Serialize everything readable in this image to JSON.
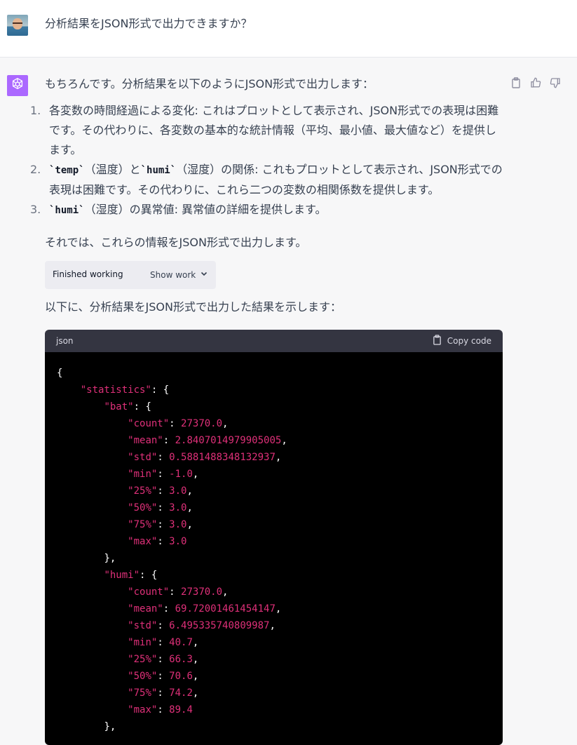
{
  "user_message": "分析結果をJSON形式で出力できますか？",
  "assistant": {
    "intro": "もちろんです。分析結果を以下のようにJSON形式で出力します：",
    "steps": [
      {
        "number": "1.",
        "code": "",
        "text": "各変数の時間経過による変化: これはプロットとして表示され、JSON形式での表現は困難です。その代わりに、各変数の基本的な統計情報（平均、最小値、最大値など）を提供します。"
      },
      {
        "number": "2.",
        "code": "`temp`",
        "mid": "（温度）と",
        "code2": "`humi`",
        "text": "（湿度）の関係: これもプロットとして表示され、JSON形式での表現は困難です。その代わりに、これら二つの変数の相関係数を提供します。"
      },
      {
        "number": "3.",
        "code": "`humi`",
        "text": "（湿度）の異常値: 異常値の詳細を提供します。"
      }
    ],
    "then_text": "それでは、これらの情報をJSON形式で出力します。",
    "finished_working": "Finished working",
    "show_work": "Show work",
    "below_text": "以下に、分析結果をJSON形式で出力した結果を示します：",
    "code_lang": "json",
    "copy_label": "Copy code"
  },
  "json_output": {
    "statistics_key": "\"statistics\"",
    "bat_key": "\"bat\"",
    "bat": [
      [
        "\"count\"",
        "27370.0"
      ],
      [
        "\"mean\"",
        "2.8407014979905005"
      ],
      [
        "\"std\"",
        "0.5881488348132937"
      ],
      [
        "\"min\"",
        "-1.0"
      ],
      [
        "\"25%\"",
        "3.0"
      ],
      [
        "\"50%\"",
        "3.0"
      ],
      [
        "\"75%\"",
        "3.0"
      ],
      [
        "\"max\"",
        "3.0"
      ]
    ],
    "humi_key": "\"humi\"",
    "humi": [
      [
        "\"count\"",
        "27370.0"
      ],
      [
        "\"mean\"",
        "69.72001461454147"
      ],
      [
        "\"std\"",
        "6.495335740809987"
      ],
      [
        "\"min\"",
        "40.7"
      ],
      [
        "\"25%\"",
        "66.3"
      ],
      [
        "\"50%\"",
        "70.6"
      ],
      [
        "\"75%\"",
        "74.2"
      ],
      [
        "\"max\"",
        "89.4"
      ]
    ]
  },
  "icons": {
    "copy_message": "clipboard-icon",
    "thumbs_up": "thumbs-up-icon",
    "thumbs_down": "thumbs-down-icon",
    "chevron": "chevron-down-icon",
    "assistant_logo": "openai-logo-icon"
  },
  "colors": {
    "accent_avatar": "#ab68ff",
    "json_key": "#df3079",
    "code_bg": "#000000",
    "code_header_bg": "#343541"
  }
}
